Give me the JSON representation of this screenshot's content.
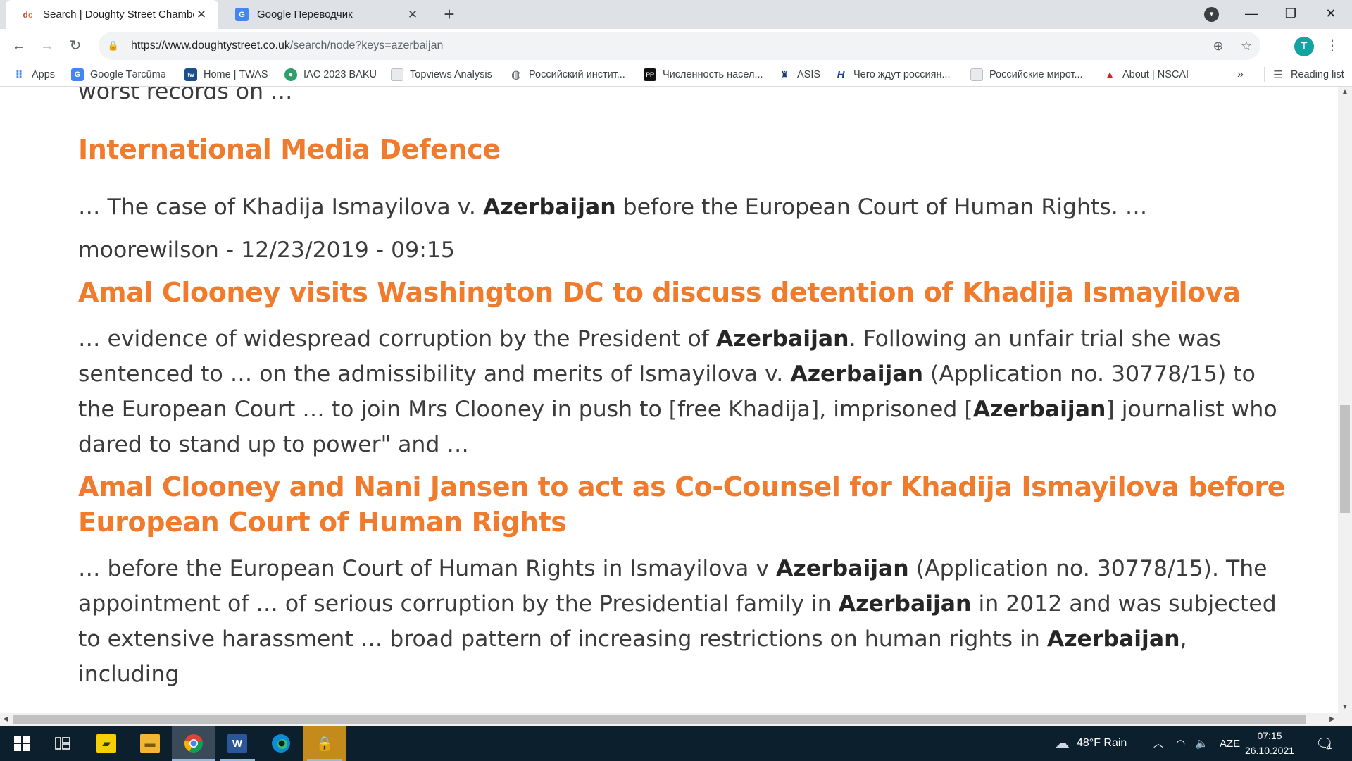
{
  "browser": {
    "tabs": [
      {
        "title": "Search | Doughty Street Chambe",
        "favicon": "dsc-logo-icon",
        "active": true
      },
      {
        "title": "Google Переводчик",
        "favicon": "google-translate-icon",
        "active": false
      }
    ],
    "new_tab_label": "+",
    "url_host": "https://www.doughtystreet.co.uk",
    "url_path": "/search/node?keys=azerbaijan",
    "profile_initial": "T",
    "bookmarks": [
      {
        "label": "Apps",
        "icon": "apps-grid-icon"
      },
      {
        "label": "Google Tərcümə",
        "icon": "google-translate-icon"
      },
      {
        "label": "Home | TWAS",
        "icon": "twas-icon"
      },
      {
        "label": "IAC 2023 BAKU",
        "icon": "iac-icon"
      },
      {
        "label": "Topviews Analysis",
        "icon": "page-icon"
      },
      {
        "label": "Российский инстит...",
        "icon": "globe-icon"
      },
      {
        "label": "Численность насел...",
        "icon": "pp-icon"
      },
      {
        "label": "ASIS",
        "icon": "asis-icon"
      },
      {
        "label": "Чего ждут россиян...",
        "icon": "h-icon"
      },
      {
        "label": "Российские мирот...",
        "icon": "page-icon"
      },
      {
        "label": "About | NSCAI",
        "icon": "nscai-icon"
      }
    ],
    "bookmarks_overflow": "»",
    "reading_list_label": "Reading list"
  },
  "page": {
    "top_cut_text": "worst records on …",
    "results": [
      {
        "title": "International Media Defence",
        "snippet_parts": [
          {
            "text": "… The case of  Khadija Ismayilova v. ",
            "bold": false
          },
          {
            "text": "Azerbaijan",
            "bold": true
          },
          {
            "text": "  before the European Court of Human Rights. …",
            "bold": false
          }
        ],
        "meta": "moorewilson - 12/23/2019 - 09:15"
      },
      {
        "title": "Amal Clooney visits Washington DC to discuss detention of Khadija Ismayilova",
        "snippet_parts": [
          {
            "text": "… evidence of widespread corruption by the President of ",
            "bold": false
          },
          {
            "text": "Azerbaijan",
            "bold": true
          },
          {
            "text": ".  Following an unfair trial she was sentenced to … on the admissibility and merits of Ismayilova v. ",
            "bold": false
          },
          {
            "text": "Azerbaijan",
            "bold": true
          },
          {
            "text": " (Application no. 30778/15) to the European Court … to join Mrs Clooney in push to [free Khadija], imprisoned [",
            "bold": false
          },
          {
            "text": "Azerbaijan",
            "bold": true
          },
          {
            "text": "] journalist who dared to stand up to power\" and …",
            "bold": false
          }
        ]
      },
      {
        "title": "Amal Clooney and Nani Jansen to act as Co-Counsel for Khadija Ismayilova before European Court of Human Rights",
        "snippet_parts": [
          {
            "text": "… before the European Court of Human Rights in Ismayilova v ",
            "bold": false
          },
          {
            "text": "Azerbaijan",
            "bold": true
          },
          {
            "text": " (Application no. 30778/15). The appointment of … of serious corruption  by the Presidential family in ",
            "bold": false
          },
          {
            "text": "Azerbaijan",
            "bold": true
          },
          {
            "text": " in 2012 and was subjected to extensive harassment … broad pattern of increasing restrictions on human rights in ",
            "bold": false
          },
          {
            "text": "Azerbaijan",
            "bold": true
          },
          {
            "text": ", including",
            "bold": false
          }
        ]
      }
    ]
  },
  "taskbar": {
    "apps": [
      "windows-start-icon",
      "task-view-icon",
      "sticky-notes-icon",
      "file-explorer-icon",
      "chrome-icon",
      "word-icon",
      "edge-icon",
      "security-app-icon"
    ],
    "weather": "48°F  Rain",
    "language": "AZE",
    "time": "07:15",
    "date": "26.10.2021",
    "notification_count": "1"
  },
  "colors": {
    "result_title": "#f07b2d",
    "tabstrip_bg": "#dee1e6",
    "taskbar_bg": "#0b1f2d",
    "profile_bg": "#12a3a3"
  }
}
